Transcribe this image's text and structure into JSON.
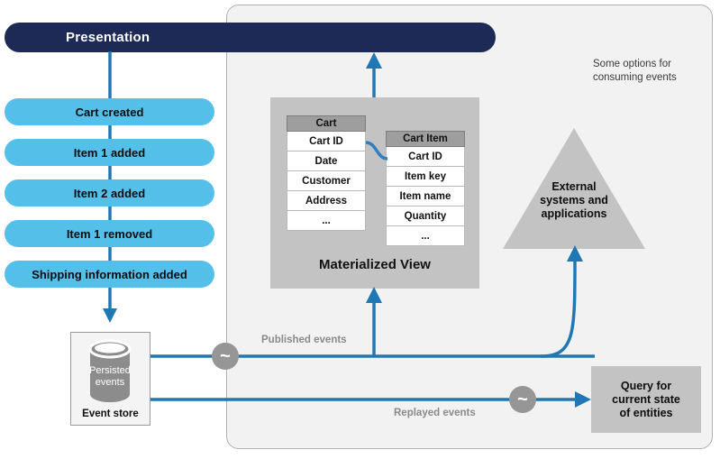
{
  "diagram": {
    "presentation": {
      "label": "Presentation"
    },
    "events": [
      {
        "label": "Cart created"
      },
      {
        "label": "Item 1 added"
      },
      {
        "label": "Item 2 added"
      },
      {
        "label": "Item 1 removed"
      },
      {
        "label": "Shipping information added"
      }
    ],
    "event_store": {
      "cylinder_label_line1": "Persisted",
      "cylinder_label_line2": "events",
      "caption": "Event store"
    },
    "materialized_view": {
      "title": "Materialized View",
      "tables": [
        {
          "name": "Cart",
          "fields": [
            "Cart ID",
            "Date",
            "Customer",
            "Address",
            "..."
          ]
        },
        {
          "name": "Cart Item",
          "fields": [
            "Cart ID",
            "Item key",
            "Item name",
            "Quantity",
            "..."
          ]
        }
      ]
    },
    "external_systems": {
      "line1": "External",
      "line2": "systems and",
      "line3": "applications"
    },
    "query_box": {
      "line1": "Query for",
      "line2": "current state",
      "line3": "of entities"
    },
    "notes": {
      "options": "Some options for consuming events"
    },
    "flows": {
      "published": "Published events",
      "replayed": "Replayed events"
    },
    "badges": {
      "tilde": "~"
    },
    "colors": {
      "presentation_bar": "#1c2a55",
      "event_pill": "#54c0ea",
      "arrow_blue": "#1f78b4",
      "region_bg": "#f2f2f2",
      "materialized_view_bg": "#c3c3c3",
      "table_header": "#9e9e9e",
      "badge_gray": "#969696",
      "flow_label_gray": "#8a8a8a"
    }
  }
}
